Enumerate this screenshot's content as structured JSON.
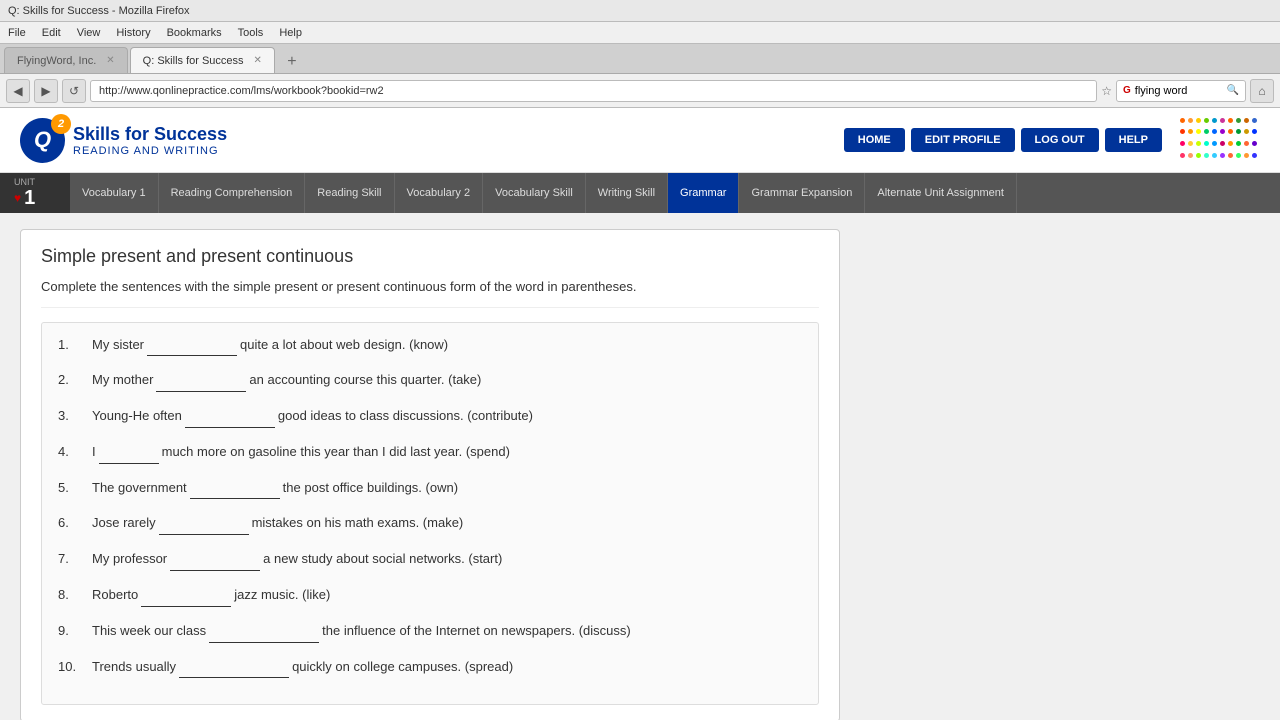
{
  "browser": {
    "title": "Q: Skills for Success - Mozilla Firefox",
    "tabs": [
      {
        "label": "FlyingWord, Inc.",
        "active": false
      },
      {
        "label": "Q: Skills for Success",
        "active": true
      }
    ],
    "address": "http://www.qonlinepractice.com/lms/workbook?bookid=rw2",
    "search_value": "flying word",
    "menu_items": [
      "File",
      "Edit",
      "View",
      "History",
      "Bookmarks",
      "Tools",
      "Help"
    ]
  },
  "header": {
    "logo_letter": "Q",
    "logo_badge": "2",
    "logo_title": "Skills for Success",
    "logo_subtitle": "READING AND WRITING",
    "buttons": [
      {
        "label": "HOME"
      },
      {
        "label": "EDIT PROFILE"
      },
      {
        "label": "LOG OUT"
      },
      {
        "label": "HELP"
      }
    ]
  },
  "unit_nav": {
    "unit_label": "UNIT",
    "unit_number": "1",
    "tabs": [
      {
        "label": "Vocabulary 1",
        "active": false
      },
      {
        "label": "Reading Comprehension",
        "active": false
      },
      {
        "label": "Reading Skill",
        "active": false
      },
      {
        "label": "Vocabulary 2",
        "active": false
      },
      {
        "label": "Vocabulary Skill",
        "active": false
      },
      {
        "label": "Writing Skill",
        "active": false
      },
      {
        "label": "Grammar",
        "active": true
      },
      {
        "label": "Grammar Expansion",
        "active": false
      },
      {
        "label": "Alternate Unit Assignment",
        "active": false
      }
    ]
  },
  "exercise": {
    "title": "Simple present and present continuous",
    "instructions": "Complete the sentences with the simple present or present continuous form of the word in parentheses.",
    "questions": [
      {
        "num": "1.",
        "text_before": "My sister",
        "blank_size": "medium",
        "text_after": "quite a lot about web design. (know)"
      },
      {
        "num": "2.",
        "text_before": "My mother",
        "blank_size": "medium",
        "text_after": "an accounting course this quarter. (take)"
      },
      {
        "num": "3.",
        "text_before": "Young-He often",
        "blank_size": "medium",
        "text_after": "good ideas to class discussions. (contribute)"
      },
      {
        "num": "4.",
        "text_before": "I",
        "blank_size": "narrow",
        "text_after": "much more on gasoline this year than I did last year. (spend)"
      },
      {
        "num": "5.",
        "text_before": "The government",
        "blank_size": "medium",
        "text_after": "the post office buildings. (own)"
      },
      {
        "num": "6.",
        "text_before": "Jose rarely",
        "blank_size": "medium",
        "text_after": "mistakes on his math exams. (make)"
      },
      {
        "num": "7.",
        "text_before": "My professor",
        "blank_size": "medium",
        "text_after": "a new study about social networks. (start)"
      },
      {
        "num": "8.",
        "text_before": "Roberto",
        "blank_size": "medium",
        "text_after": "jazz music. (like)"
      },
      {
        "num": "9.",
        "text_before": "This week our class",
        "blank_size": "wide",
        "text_after": "the influence of the Internet on newspapers. (discuss)"
      },
      {
        "num": "10.",
        "text_before": "Trends usually",
        "blank_size": "wide",
        "text_after": "quickly on college campuses. (spread)"
      }
    ]
  },
  "dots": {
    "colors": [
      "#ff6600",
      "#ff9933",
      "#ffcc00",
      "#66cc00",
      "#0099cc",
      "#cc3399",
      "#ff6600",
      "#339933",
      "#cc6600",
      "#3366cc",
      "#ff3300",
      "#ff9900",
      "#ffff00",
      "#00cc66",
      "#0066ff",
      "#9900cc",
      "#ff6600",
      "#009933",
      "#cc9900",
      "#0033ff",
      "#ff0066",
      "#ffcc33",
      "#ccff00",
      "#00ffcc",
      "#0099ff",
      "#cc0066",
      "#ff9900",
      "#00cc33",
      "#ff6633",
      "#6600cc",
      "#ff3366",
      "#ff9966",
      "#99ff00",
      "#33ffcc",
      "#33ccff",
      "#9933ff",
      "#ff6633",
      "#33ff66",
      "#ff9933",
      "#3333ff"
    ]
  }
}
